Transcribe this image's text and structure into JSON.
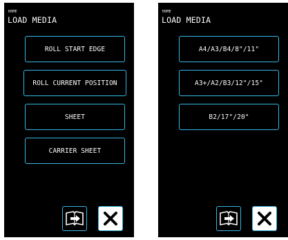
{
  "left_panel": {
    "breadcrumb": "HOME",
    "title": "LOAD MEDIA",
    "buttons": [
      {
        "label": "ROLL START EDGE"
      },
      {
        "label": "ROLL CURRENT POSITION"
      },
      {
        "label": "SHEET"
      },
      {
        "label": "CARRIER SHEET"
      }
    ],
    "footer_icons": [
      "book-arrow-icon",
      "close-x-icon"
    ]
  },
  "right_panel": {
    "breadcrumb": "HOME",
    "title": "LOAD MEDIA",
    "buttons": [
      {
        "label": "A4/A3/B4/8\"/11\""
      },
      {
        "label": "A3+/A2/B3/12\"/15\""
      },
      {
        "label": "B2/17\"/20\""
      }
    ],
    "footer_icons": [
      "book-arrow-icon",
      "close-x-icon"
    ]
  },
  "colors": {
    "screen_background": "#000000",
    "button_border": "#35b8e6",
    "text": "#ffffff",
    "close_button_background": "#ffffff"
  }
}
